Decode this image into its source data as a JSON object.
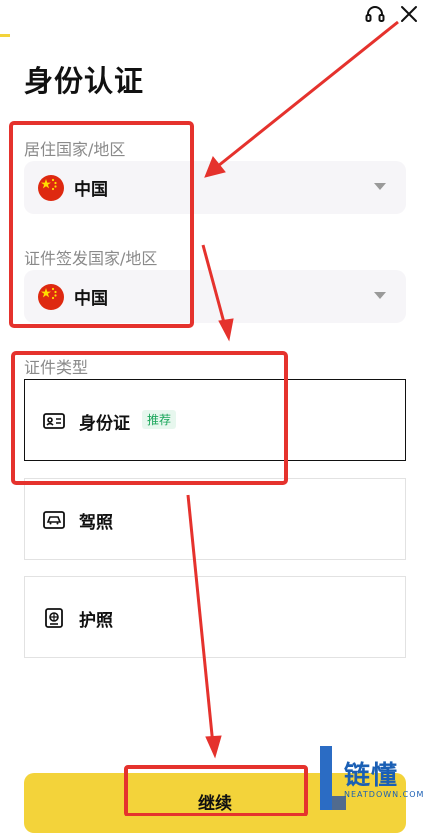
{
  "header": {
    "title": "身份认证",
    "icons": [
      "headset-icon",
      "close-icon"
    ]
  },
  "residence": {
    "label": "居住国家/地区",
    "value": "中国",
    "flag": "china-flag-icon"
  },
  "issuing": {
    "label": "证件签发国家/地区",
    "value": "中国",
    "flag": "china-flag-icon"
  },
  "doc_type": {
    "label": "证件类型",
    "options": [
      {
        "label": "身份证",
        "badge": "推荐",
        "icon": "id-card-icon",
        "selected": true
      },
      {
        "label": "驾照",
        "icon": "driver-license-icon",
        "selected": false
      },
      {
        "label": "护照",
        "icon": "passport-icon",
        "selected": false
      }
    ]
  },
  "continue_button": {
    "label": "继续"
  },
  "watermark": {
    "brand": "链懂",
    "url": "NEATDOWN.COM"
  },
  "colors": {
    "accent": "#f3d33a",
    "annotation": "#e5322d",
    "badge_text": "#1aa65a"
  }
}
